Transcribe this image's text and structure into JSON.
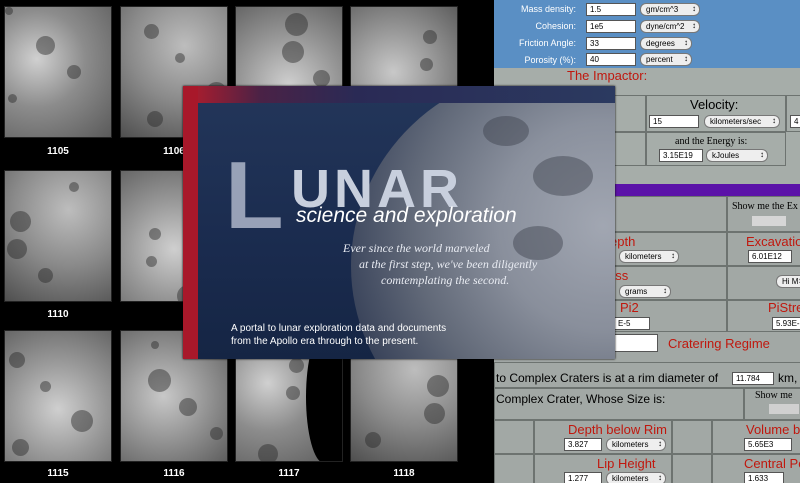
{
  "photos": [
    {
      "num": "1105"
    },
    {
      "num": "1106"
    },
    {
      "num": ""
    },
    {
      "num": ""
    },
    {
      "num": "1110"
    },
    {
      "num": ""
    },
    {
      "num": ""
    },
    {
      "num": ""
    },
    {
      "num": "1115"
    },
    {
      "num": "1116"
    },
    {
      "num": "1117"
    },
    {
      "num": "1118"
    }
  ],
  "banner": {
    "logo_first": "L",
    "logo_rest": "UNAR",
    "subtitle": "science and exploration",
    "quote": [
      "Ever since the world marveled",
      "at the first step, we've been diligently",
      "comtemplating the second."
    ],
    "desc": [
      "A portal to lunar exploration data and documents",
      "from the Apollo era through to the present."
    ]
  },
  "target": {
    "mass_density_label": "Mass density:",
    "mass_density_value": "1.5",
    "mass_density_unit": "gm/cm^3",
    "cohesion_label": "Cohesion:",
    "cohesion_value": "1e5",
    "cohesion_unit": "dyne/cm^2",
    "friction_label": "Friction Angle:",
    "friction_value": "33",
    "friction_unit": "degrees",
    "porosity_label": "Porosity (%):",
    "porosity_value": "40",
    "porosity_unit": "percent"
  },
  "impactor": {
    "heading": "The Impactor:",
    "velocity_label": "Velocity:",
    "velocity_value": "15",
    "velocity_unit": "kilometers/sec",
    "edge_partial": "4",
    "energy_label": "and the Energy is:",
    "energy_value": "3.15E19",
    "energy_unit": "kJoules"
  },
  "results": {
    "show_me_1": "Show me the Ex",
    "depth_label": "epth",
    "depth_unit": "kilometers",
    "excavation_label": "Excavatio",
    "excavation_value": "6.01E12",
    "mass_label": "or Mass",
    "mass_unit": "grams",
    "hi_button": "Hi M",
    "pi2_label": "Pi2",
    "pi2_value": "E-5",
    "pistre_label": "PiStre",
    "pistre_value": "5.93E-",
    "regime_label": "Cratering Regime",
    "complex_line_1": "to Complex Craters is at a rim diameter of",
    "complex_value": "11.784",
    "complex_unit": "km,",
    "complex_line_2": "Complex Crater, Whose Size is:",
    "show_me_2": "Show me",
    "depth_rim_label": "Depth below Rim",
    "depth_rim_value": "3.827",
    "depth_rim_unit": "kilometers",
    "volume_label": "Volume b",
    "volume_value": "5.65E3",
    "lip_label": "Lip Height",
    "lip_value": "1.277",
    "lip_unit": "kilometers",
    "central_label": "Central Pe",
    "central_value": "1.633"
  }
}
